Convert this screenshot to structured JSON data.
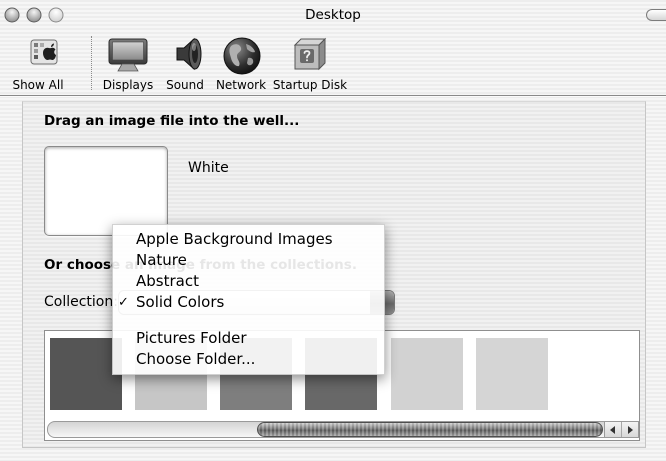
{
  "window": {
    "title": "Desktop"
  },
  "toolbar": {
    "items": [
      {
        "label": "Show All",
        "icon": "show-all-icon"
      },
      {
        "label": "Displays",
        "icon": "display-icon"
      },
      {
        "label": "Sound",
        "icon": "speaker-icon"
      },
      {
        "label": "Network",
        "icon": "globe-icon"
      },
      {
        "label": "Startup Disk",
        "icon": "hard-disk-icon"
      }
    ]
  },
  "desktop_pane": {
    "drag_heading": "Drag an image file into the well...",
    "current_image_name": "White",
    "collections_heading": "Or choose an image from the collections.",
    "collection_label": "Collection:"
  },
  "collection_menu": {
    "check_mark": "✓",
    "items": [
      {
        "label": "Apple Background Images",
        "checked": false
      },
      {
        "label": "Nature",
        "checked": false
      },
      {
        "label": "Abstract",
        "checked": false
      },
      {
        "label": "Solid Colors",
        "checked": true
      }
    ],
    "folder_items": [
      {
        "label": "Pictures Folder",
        "checked": false
      },
      {
        "label": "Choose Folder...",
        "checked": false
      }
    ]
  },
  "thumbnails": [
    {
      "color": "#555555"
    },
    {
      "color": "#c6c6c6"
    },
    {
      "color": "#7e7e7e"
    },
    {
      "color": "#686868"
    },
    {
      "color": "#d2d2d2"
    },
    {
      "color": "#d5d5d5"
    }
  ]
}
